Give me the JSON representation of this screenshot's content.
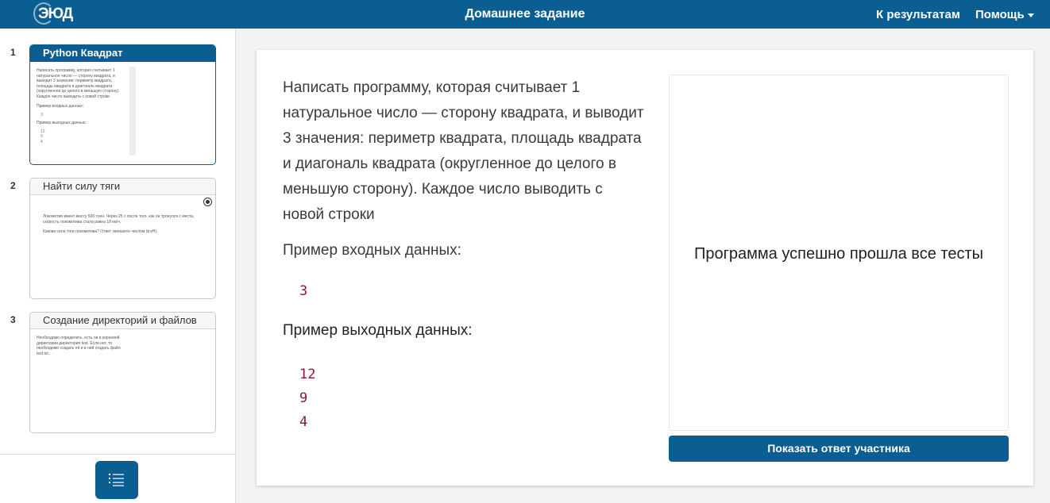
{
  "header": {
    "logo": "ЭЮД",
    "title": "Домашнее задание",
    "results_link": "К результатам",
    "help_menu": "Помощь"
  },
  "sidebar": {
    "tasks": [
      {
        "number": "1",
        "title": "Python Квадрат",
        "preview_lines": [
          "Написать программу, которая считывает 1",
          "натуральное число — сторону квадрата, и",
          "выводит 3 значения: периметр квадрата,",
          "площадь квадрата и диагональ квадрата",
          "(округленное до целого в меньшую сторону).",
          "Каждое число выводить с новой строки"
        ],
        "preview_in_label": "Пример входных данных:",
        "preview_in": "3",
        "preview_out_label": "Пример выходных данных:",
        "preview_out": [
          "12",
          "9",
          "4"
        ]
      },
      {
        "number": "2",
        "title": "Найти силу тяги",
        "preview_lines": [
          "Локомотив имеет массу 500 тонн. Через 25 с после того, как он тронулся с места,",
          "скорость локомотива стала равна 18 км/ч.",
          "Какова сила тяги локомотива? Ответ запишите числом (в кН)."
        ]
      },
      {
        "number": "3",
        "title": "Создание директорий и файлов",
        "preview_lines": [
          "Необходимо определить, есть ли в корневой",
          "директории директория test. Если нет, то",
          "необходимо создать её и в ней создать файл",
          "test.txt."
        ]
      }
    ],
    "list_icon": "list-icon"
  },
  "main": {
    "statement": "Написать программу, которая считывает 1 натуральное число — сторону квадрата, и выводит 3 значения: периметр квадрата, площадь квадрата и диагональ квадрата (округленное до целого в меньшую сторону). Каждое число выводить с новой строки",
    "input_label": "Пример входных данных:",
    "input_value": "3",
    "output_label": "Пример выходных данных:",
    "output_values": [
      "12",
      "9",
      "4"
    ],
    "result_text": "Программа успешно прошла все тесты",
    "show_answer_button": "Показать ответ участника"
  },
  "colors": {
    "brand": "#0b5e91",
    "code": "#8b1a2b"
  }
}
